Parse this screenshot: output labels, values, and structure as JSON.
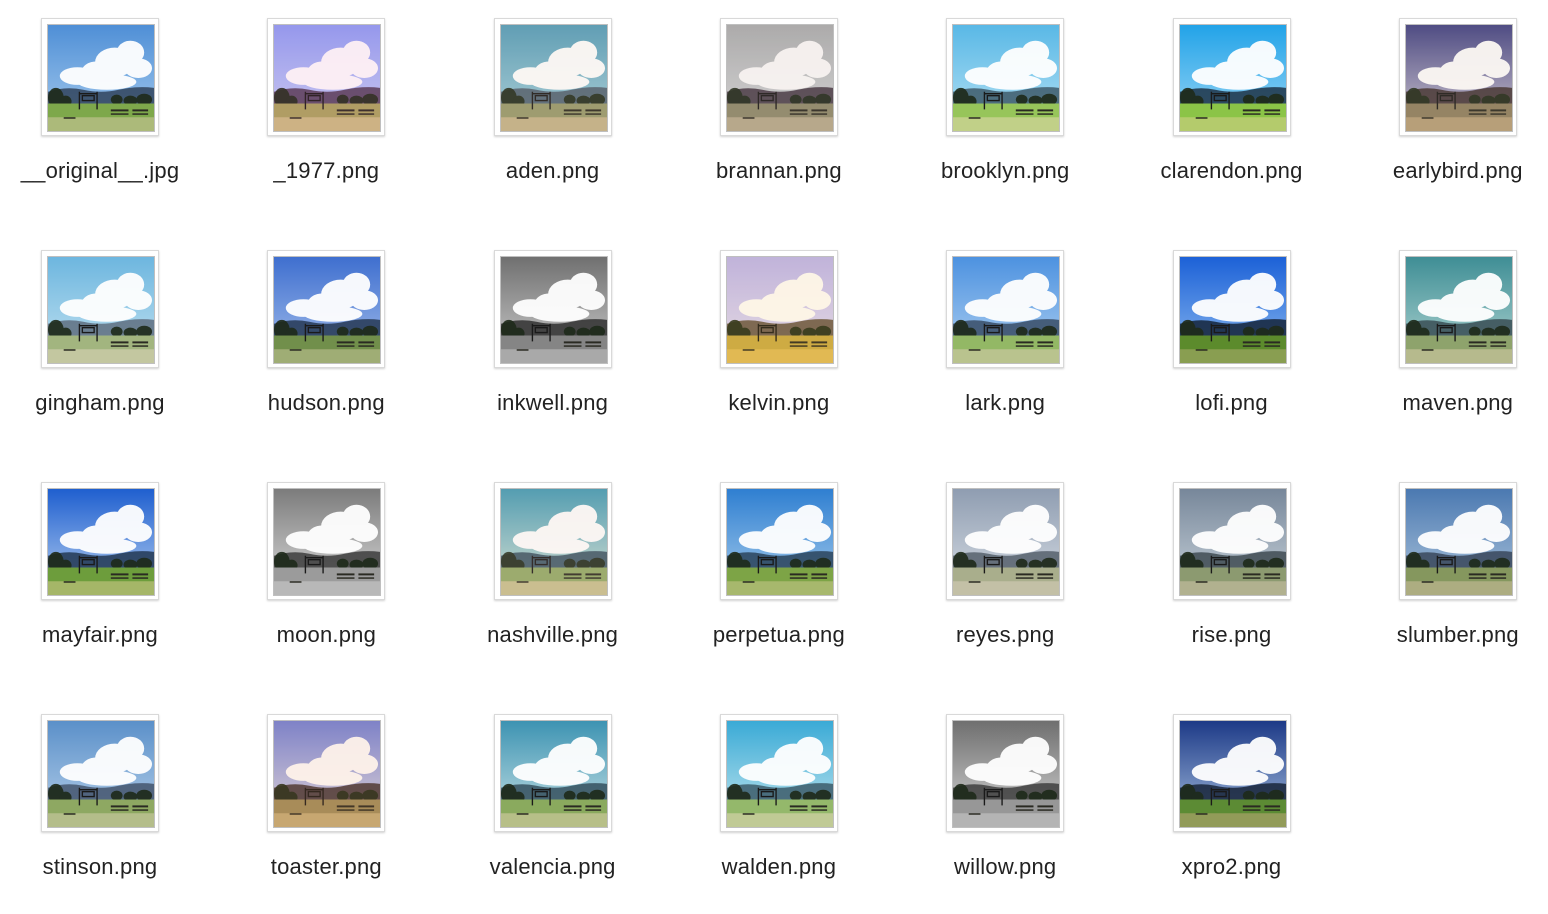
{
  "files": [
    {
      "name": "__original__.jpg",
      "icon": "image-thumbnail-icon",
      "filter": "original"
    },
    {
      "name": "_1977.png",
      "icon": "image-thumbnail-icon",
      "filter": "1977"
    },
    {
      "name": "aden.png",
      "icon": "image-thumbnail-icon",
      "filter": "aden"
    },
    {
      "name": "brannan.png",
      "icon": "image-thumbnail-icon",
      "filter": "brannan"
    },
    {
      "name": "brooklyn.png",
      "icon": "image-thumbnail-icon",
      "filter": "brooklyn"
    },
    {
      "name": "clarendon.png",
      "icon": "image-thumbnail-icon",
      "filter": "clarendon"
    },
    {
      "name": "earlybird.png",
      "icon": "image-thumbnail-icon",
      "filter": "earlybird"
    },
    {
      "name": "gingham.png",
      "icon": "image-thumbnail-icon",
      "filter": "gingham"
    },
    {
      "name": "hudson.png",
      "icon": "image-thumbnail-icon",
      "filter": "hudson"
    },
    {
      "name": "inkwell.png",
      "icon": "image-thumbnail-icon",
      "filter": "inkwell"
    },
    {
      "name": "kelvin.png",
      "icon": "image-thumbnail-icon",
      "filter": "kelvin"
    },
    {
      "name": "lark.png",
      "icon": "image-thumbnail-icon",
      "filter": "lark"
    },
    {
      "name": "lofi.png",
      "icon": "image-thumbnail-icon",
      "filter": "lofi"
    },
    {
      "name": "maven.png",
      "icon": "image-thumbnail-icon",
      "filter": "maven"
    },
    {
      "name": "mayfair.png",
      "icon": "image-thumbnail-icon",
      "filter": "mayfair"
    },
    {
      "name": "moon.png",
      "icon": "image-thumbnail-icon",
      "filter": "moon"
    },
    {
      "name": "nashville.png",
      "icon": "image-thumbnail-icon",
      "filter": "nashville"
    },
    {
      "name": "perpetua.png",
      "icon": "image-thumbnail-icon",
      "filter": "perpetua"
    },
    {
      "name": "reyes.png",
      "icon": "image-thumbnail-icon",
      "filter": "reyes"
    },
    {
      "name": "rise.png",
      "icon": "image-thumbnail-icon",
      "filter": "rise"
    },
    {
      "name": "slumber.png",
      "icon": "image-thumbnail-icon",
      "filter": "slumber"
    },
    {
      "name": "stinson.png",
      "icon": "image-thumbnail-icon",
      "filter": "stinson"
    },
    {
      "name": "toaster.png",
      "icon": "image-thumbnail-icon",
      "filter": "toaster"
    },
    {
      "name": "valencia.png",
      "icon": "image-thumbnail-icon",
      "filter": "valencia"
    },
    {
      "name": "walden.png",
      "icon": "image-thumbnail-icon",
      "filter": "walden"
    },
    {
      "name": "willow.png",
      "icon": "image-thumbnail-icon",
      "filter": "willow"
    },
    {
      "name": "xpro2.png",
      "icon": "image-thumbnail-icon",
      "filter": "xpro2"
    }
  ]
}
